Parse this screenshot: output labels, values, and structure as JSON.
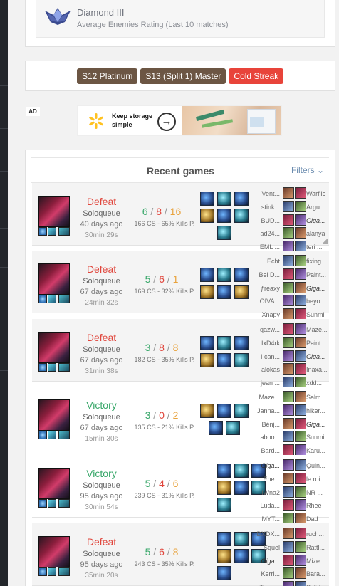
{
  "rank": {
    "name": "Diamond III",
    "subtitle": "Average Enemies Rating (Last 10 matches)"
  },
  "tags": [
    "S12 Platinum",
    "S13 (Split 1) Master",
    "Cold Streak"
  ],
  "tag_colors": {
    "season": "#6c5644",
    "streak": "#e8443a"
  },
  "ad": {
    "badge": "AD",
    "text": "Keep storage simple",
    "arrow_icon": "arrow-right-icon"
  },
  "games_section": {
    "title": "Recent games",
    "filters_label": "Filters ⌄"
  },
  "games": [
    {
      "result": "Defeat",
      "queue": "Soloqueue",
      "ago": "40 days ago",
      "duration": "30min 29s",
      "k": "6",
      "d": "8",
      "a": "16",
      "stats": "166 CS - 65% Kills P.",
      "blue_team": [
        "Vent...",
        "stink...",
        "BUD...",
        "ad24...",
        "EML ..."
      ],
      "red_team": [
        "Warflic",
        "Argu...",
        "Giga...",
        "alanya",
        "teri ..."
      ],
      "self_side": "red",
      "self_index": 2
    },
    {
      "result": "Defeat",
      "queue": "Soloqueue",
      "ago": "67 days ago",
      "duration": "24min 32s",
      "k": "5",
      "d": "6",
      "a": "1",
      "stats": "169 CS - 32% Kills P.",
      "blue_team": [
        "Echt",
        "Bel D...",
        "ƒreaxy",
        "OIVA...",
        "Xnapy"
      ],
      "red_team": [
        "fixing...",
        "Paint...",
        "Giga...",
        "beyo...",
        "Sunmi"
      ],
      "self_side": "red",
      "self_index": 2
    },
    {
      "result": "Defeat",
      "queue": "Soloqueue",
      "ago": "67 days ago",
      "duration": "31min 38s",
      "k": "3",
      "d": "8",
      "a": "8",
      "stats": "182 CS - 35% Kills P.",
      "blue_team": [
        "qazw...",
        "IxD4rk",
        "I can...",
        "alokas",
        "jean ..."
      ],
      "red_team": [
        "Maze...",
        "Paint...",
        "Giga...",
        "Inaxa...",
        "xdd..."
      ],
      "self_side": "red",
      "self_index": 2
    },
    {
      "result": "Victory",
      "queue": "Soloqueue",
      "ago": "67 days ago",
      "duration": "15min 30s",
      "k": "3",
      "d": "0",
      "a": "2",
      "stats": "135 CS - 21% Kills P.",
      "blue_team": [
        "Maze...",
        "Janna...",
        "Bénj...",
        "aboo...",
        "Bard..."
      ],
      "red_team": [
        "Salm...",
        "hiker...",
        "Giga...",
        "Sunmi",
        "Karu..."
      ],
      "self_side": "red",
      "self_index": 2
    },
    {
      "result": "Victory",
      "queue": "Soloqueue",
      "ago": "95 days ago",
      "duration": "30min 54s",
      "k": "5",
      "d": "4",
      "a": "6",
      "stats": "239 CS - 31% Kills P.",
      "blue_team": [
        "Giga...",
        "Ene...",
        "iWna2",
        "Luda...",
        "MYT..."
      ],
      "red_team": [
        "Quin...",
        "le roi...",
        "NR ...",
        "Rhee",
        "Dad"
      ],
      "self_side": "blue",
      "self_index": 0
    },
    {
      "result": "Defeat",
      "queue": "Soloqueue",
      "ago": "95 days ago",
      "duration": "35min 20s",
      "k": "5",
      "d": "6",
      "a": "8",
      "stats": "243 CS - 35% Kills P.",
      "blue_team": [
        "DXDX...",
        "Squel",
        "Giga...",
        "Kerri...",
        "Toxyne"
      ],
      "red_team": [
        "ruch...",
        "Rattl...",
        "Mize...",
        "Bara...",
        "Solid..."
      ],
      "self_side": "blue",
      "self_index": 2
    }
  ]
}
